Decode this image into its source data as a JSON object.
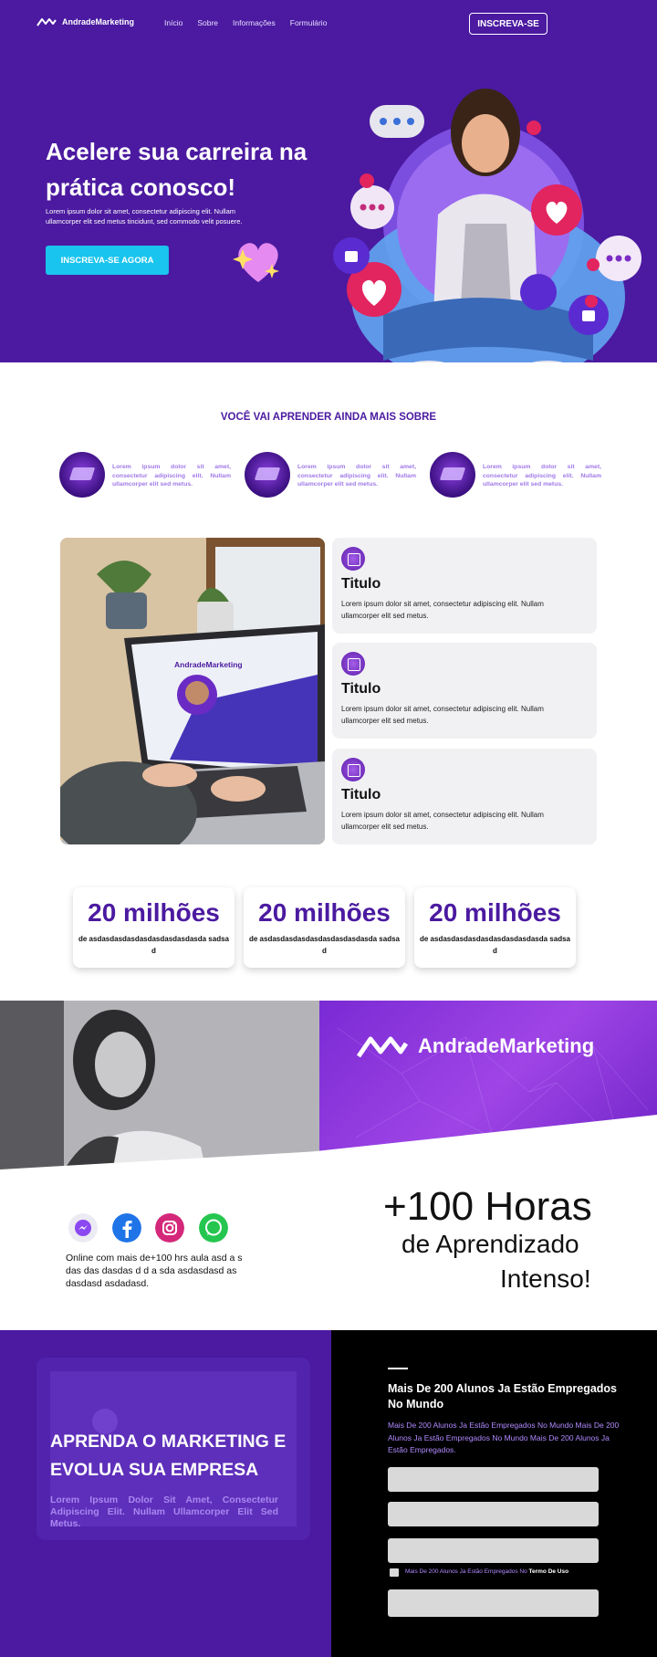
{
  "header": {
    "brand": "AndradeMarketing",
    "nav": [
      "Início",
      "Sobre",
      "Informações",
      "Formulário"
    ],
    "cta": "INSCREVA-SE"
  },
  "hero": {
    "title": "Acelere sua carreira na prática conosco!",
    "text": "Lorem ipsum dolor sit amet, consectetur adipiscing elit. Nullam ullamcorper elit sed metus tincidunt, sed commodo velit posuere.",
    "button": "INSCREVA-SE AGORA"
  },
  "learn": {
    "title": "VOCÊ VAI APRENDER AINDA MAIS SOBRE",
    "items": [
      "Lorem ipsum dolor sit amet, consectetur adipiscing elit. Nullam ullamcorper elit sed metus.",
      "Lorem ipsum dolor sit amet, consectetur adipiscing elit. Nullam ullamcorper elit sed metus.",
      "Lorem ipsum dolor sit amet, consectetur adipiscing elit. Nullam ullamcorper elit sed metus."
    ]
  },
  "laptop_screen_brand": "AndradeMarketing",
  "features": [
    {
      "title": "Titulo",
      "text": "Lorem ipsum dolor sit amet, consectetur adipiscing elit. Nullam ullamcorper elit sed metus."
    },
    {
      "title": "Titulo",
      "text": "Lorem ipsum dolor sit amet, consectetur adipiscing elit. Nullam ullamcorper elit sed metus."
    },
    {
      "title": "Titulo",
      "text": "Lorem ipsum dolor sit amet, consectetur adipiscing elit. Nullam ullamcorper elit sed metus."
    }
  ],
  "stats": [
    {
      "value": "20 milhões",
      "desc": "de asdasdasdasdasdasdasdasdasda sadsad"
    },
    {
      "value": "20 milhões",
      "desc": "de asdasdasdasdasdasdasdasdasda sadsad"
    },
    {
      "value": "20 milhões",
      "desc": "de asdasdasdasdasdasdasdasdasda sadsad"
    }
  ],
  "banner": {
    "brand": "AndradeMarketing"
  },
  "social": {
    "icons": [
      "messenger-icon",
      "facebook-icon",
      "instagram-icon",
      "whatsapp-icon"
    ],
    "text": "Online com mais de+100 hrs aula asd a s das das dasdas d d a sda asdasdasd as dasdasd asdadasd."
  },
  "hours": {
    "big": "+100 Horas",
    "line1": "de Aprendizado",
    "line2": "Intenso!"
  },
  "bottom": {
    "title": "APRENDA O MARKETING E EVOLUA SUA EMPRESA",
    "text": "Lorem Ipsum Dolor Sit Amet, Consectetur Adipiscing Elit. Nullam Ullamcorper Elit Sed Metus."
  },
  "form": {
    "title": "Mais De 200 Alunos Ja Estão Empregados No Mundo",
    "sub": "Mais De 200 Alunos Ja Estão Empregados No Mundo Mais De 200 Alunos Ja Estão Empregados No Mundo Mais De 200 Alunos Ja Estão Empregados.",
    "terms_prefix": "Mais De 200 Alunos Ja Estão Empregados No",
    "terms_link": "Termo De Uso"
  },
  "colors": {
    "primary": "#4b1aa0",
    "accent": "#19c4ee",
    "light_purple": "#a07ae8",
    "form_text": "#b08aff"
  }
}
